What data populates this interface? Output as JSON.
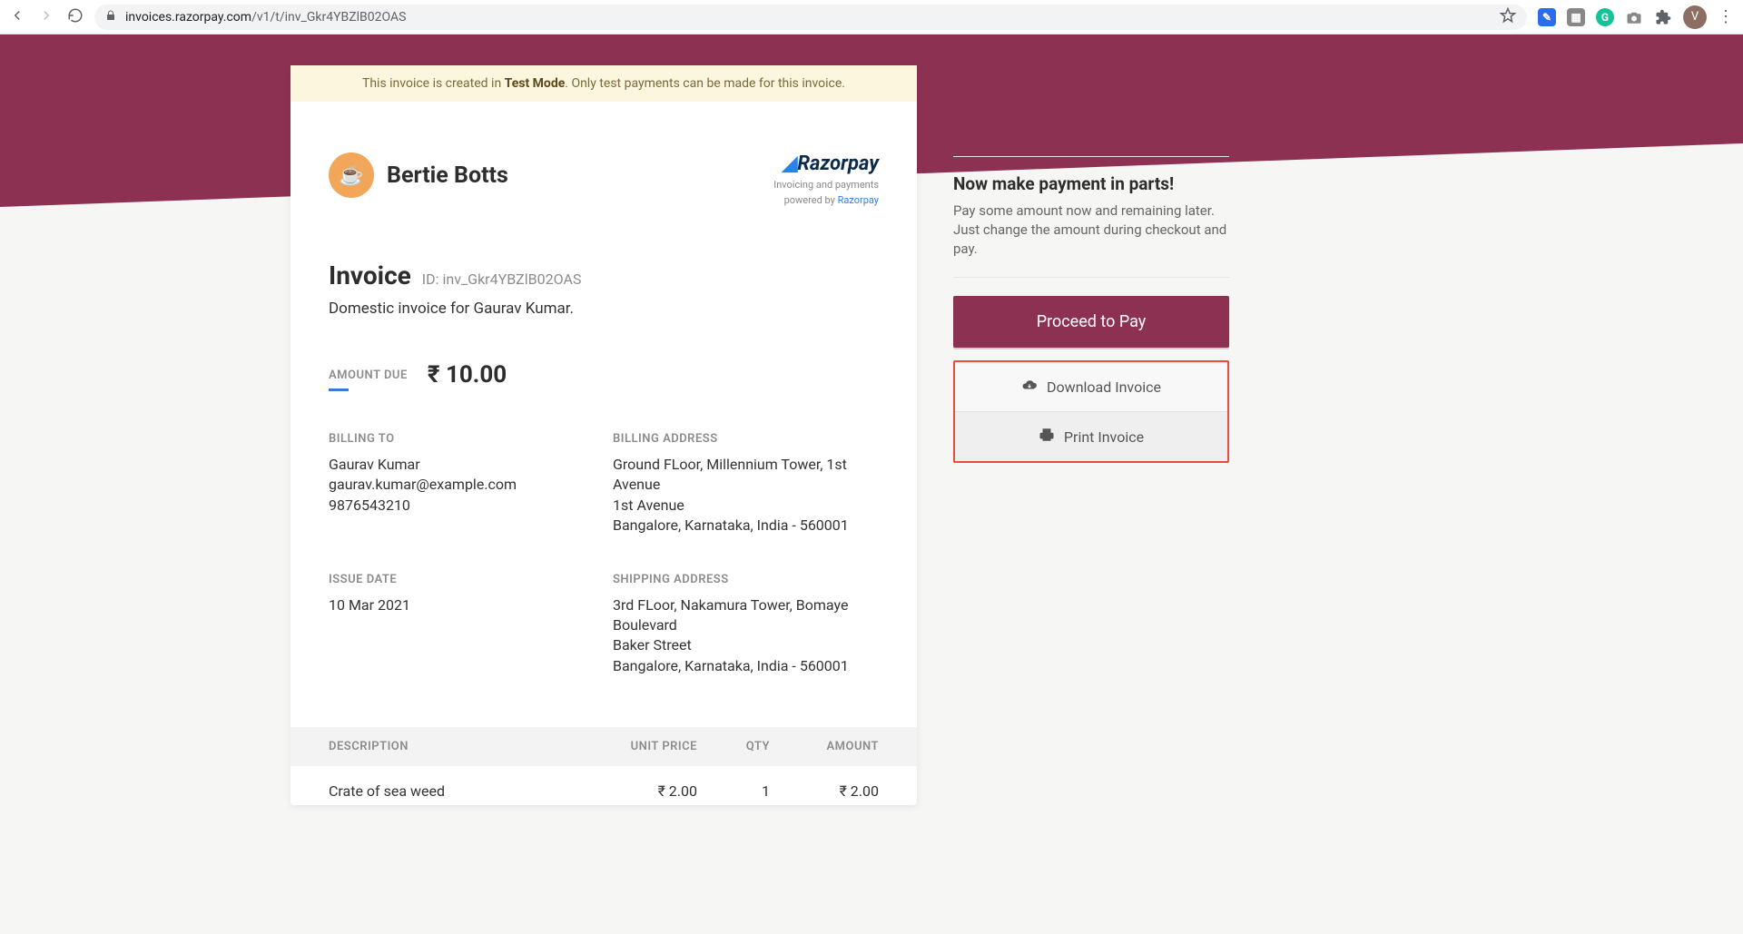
{
  "browser": {
    "url_host": "invoices.razorpay.com",
    "url_path": "/v1/t/inv_Gkr4YBZlB02OAS",
    "avatar_letter": "V"
  },
  "banner": {
    "text_pre": "This invoice is created in ",
    "text_bold": "Test Mode",
    "text_post": ". Only test payments can be made for this invoice."
  },
  "merchant": {
    "name": "Bertie Botts"
  },
  "razorpay": {
    "logo_text": "Razorpay",
    "sub_text_a": "Invoicing and payments",
    "sub_text_b": "powered by ",
    "sub_text_link": "Razorpay"
  },
  "invoice": {
    "title": "Invoice",
    "id_label": "ID: inv_Gkr4YBZlB02OAS",
    "description": "Domestic invoice for Gaurav Kumar.",
    "amount_due_label": "AMOUNT DUE",
    "amount_due_value": "₹ 10.00"
  },
  "billing_to": {
    "label": "BILLING TO",
    "name": "Gaurav Kumar",
    "email": "gaurav.kumar@example.com",
    "phone": "9876543210"
  },
  "billing_address": {
    "label": "BILLING ADDRESS",
    "line1": "Ground FLoor, Millennium Tower, 1st Avenue",
    "line2": "1st Avenue",
    "line3": "Bangalore, Karnataka, India - 560001"
  },
  "issue_date": {
    "label": "ISSUE DATE",
    "value": "10 Mar 2021"
  },
  "shipping_address": {
    "label": "SHIPPING ADDRESS",
    "line1": "3rd FLoor, Nakamura Tower, Bomaye Boulevard",
    "line2": "Baker Street",
    "line3": "Bangalore, Karnataka, India - 560001"
  },
  "line_items": {
    "head": {
      "description": "DESCRIPTION",
      "unit_price": "UNIT PRICE",
      "qty": "QTY",
      "amount": "AMOUNT"
    },
    "rows": [
      {
        "description": "Crate of sea weed",
        "unit_price": "₹ 2.00",
        "qty": "1",
        "amount": "₹ 2.00"
      }
    ]
  },
  "side": {
    "title": "Now make payment in parts!",
    "text": "Pay some amount now and remaining later. Just change the amount during checkout and pay.",
    "pay_label": "Proceed to Pay",
    "download_label": "Download Invoice",
    "print_label": "Print Invoice"
  }
}
